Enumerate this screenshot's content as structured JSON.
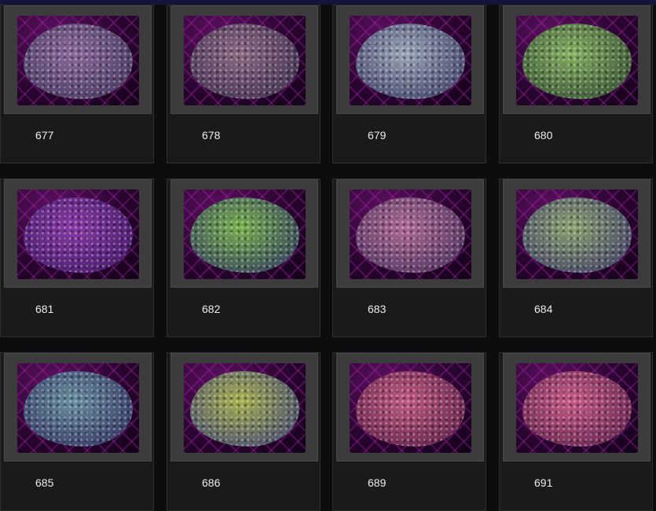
{
  "gallery": {
    "items": [
      {
        "label": "677",
        "colors": [
          "#8a6a9e",
          "#4f3f66"
        ]
      },
      {
        "label": "678",
        "colors": [
          "#8c6a84",
          "#4a3858"
        ]
      },
      {
        "label": "679",
        "colors": [
          "#9aa6b8",
          "#4a4c72"
        ]
      },
      {
        "label": "680",
        "colors": [
          "#86b060",
          "#3f5a3a"
        ]
      },
      {
        "label": "681",
        "colors": [
          "#8a3aa6",
          "#4c1f72"
        ]
      },
      {
        "label": "682",
        "colors": [
          "#7ab24e",
          "#3a4a5e"
        ]
      },
      {
        "label": "683",
        "colors": [
          "#b06a96",
          "#5a3a66"
        ]
      },
      {
        "label": "684",
        "colors": [
          "#8aa470",
          "#4a4a6a"
        ]
      },
      {
        "label": "685",
        "colors": [
          "#6a90a0",
          "#3a3e6a"
        ]
      },
      {
        "label": "686",
        "colors": [
          "#a8b04e",
          "#4e5470"
        ]
      },
      {
        "label": "689",
        "colors": [
          "#c05a84",
          "#6a2850"
        ]
      },
      {
        "label": "691",
        "colors": [
          "#c85a8a",
          "#6e2a54"
        ]
      }
    ]
  }
}
